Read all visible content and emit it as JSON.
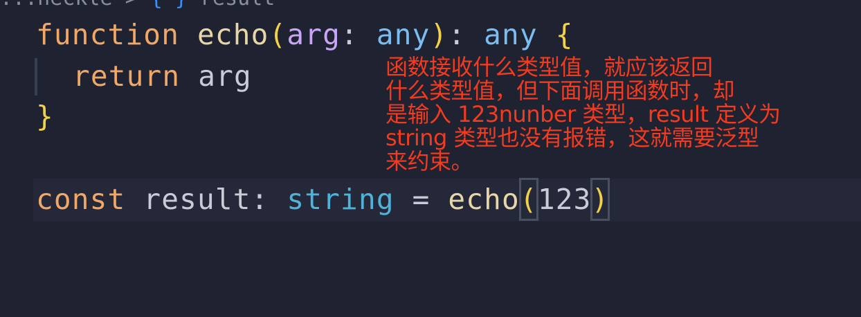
{
  "breadcrumb": {
    "path": "...neckle",
    "separator": ">",
    "symbol_icon": "{ }",
    "current": "result"
  },
  "code": {
    "line1": {
      "keyword": "function",
      "name": "echo",
      "open_paren": "(",
      "param": "arg",
      "colon": ":",
      "param_type": "any",
      "close_paren": ")",
      "colon2": ":",
      "return_type": "any",
      "open_brace": "{"
    },
    "line2": {
      "keyword": "return",
      "value": "arg"
    },
    "line3": {
      "close_brace": "}"
    },
    "line4": {
      "keyword": "const",
      "name": "result",
      "colon": ":",
      "type": "string",
      "equals": "=",
      "call": "echo",
      "open_paren": "(",
      "arg": "123",
      "close_paren": ")"
    }
  },
  "annotation": {
    "lines": [
      "函数接收什么类型值，就应该返回",
      "什么类型值，但下面调用函数时，却",
      "是输入 123nunber 类型，result 定义为",
      "string 类型也没有报错，这就需要泛型",
      "来约束。"
    ],
    "color": "#f23b1f"
  },
  "colors": {
    "background": "#1f2230",
    "keyword": "#f0a868",
    "function_name": "#e6d6a8",
    "bracket": "#f3d24a",
    "param": "#c8a6f5",
    "type": "#7bbdf0"
  }
}
